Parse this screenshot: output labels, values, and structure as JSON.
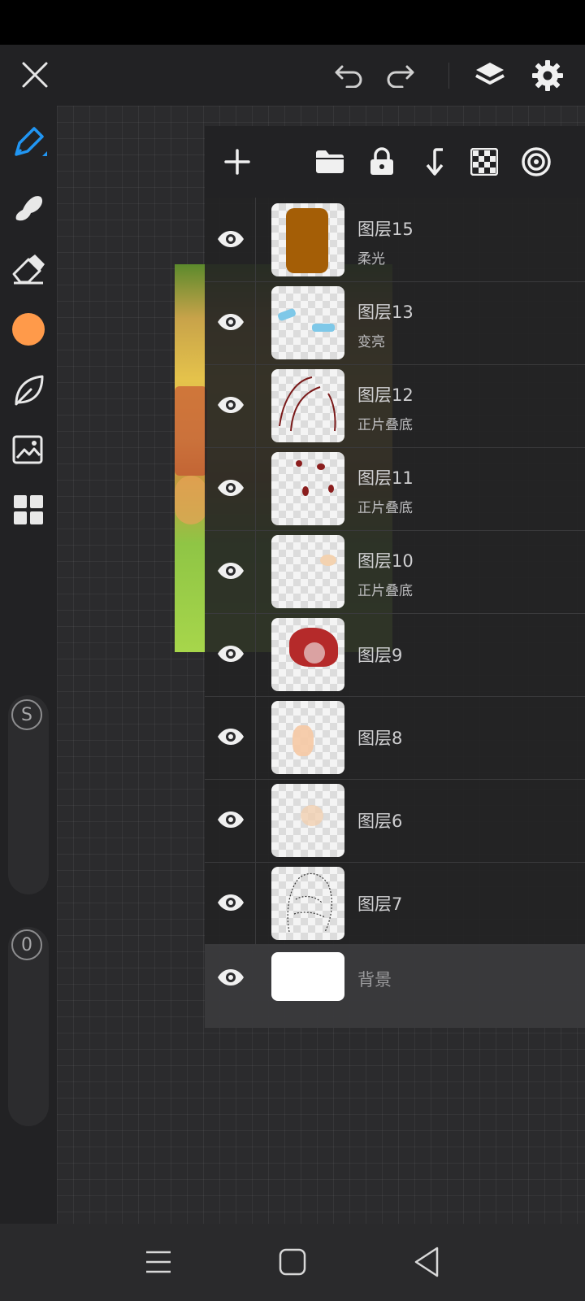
{
  "layers": [
    {
      "name": "图层15",
      "blend": "柔光",
      "thumb": "brown"
    },
    {
      "name": "图层13",
      "blend": "变亮",
      "thumb": "blue"
    },
    {
      "name": "图层12",
      "blend": "正片叠底",
      "thumb": "strokes"
    },
    {
      "name": "图层11",
      "blend": "正片叠底",
      "thumb": "reddots"
    },
    {
      "name": "图层10",
      "blend": "正片叠底",
      "thumb": "peach"
    },
    {
      "name": "图层9",
      "blend": "",
      "thumb": "hair"
    },
    {
      "name": "图层8",
      "blend": "",
      "thumb": "skin"
    },
    {
      "name": "图层6",
      "blend": "",
      "thumb": "skin2"
    },
    {
      "name": "图层7",
      "blend": "",
      "thumb": "lineart"
    },
    {
      "name": "背景",
      "blend": "",
      "thumb": "white"
    }
  ],
  "sliders": {
    "size_label": "S",
    "opacity_label": "0"
  },
  "colors": {
    "current_color": "#ff9a4a",
    "accent": "#2196f3"
  },
  "icons": {
    "top": [
      "close-icon",
      "undo-icon",
      "redo-icon",
      "layers-icon",
      "settings-icon"
    ],
    "panel": [
      "add-layer-icon",
      "folder-icon",
      "lock-icon",
      "merge-down-icon",
      "checkerboard-icon",
      "target-icon"
    ]
  }
}
